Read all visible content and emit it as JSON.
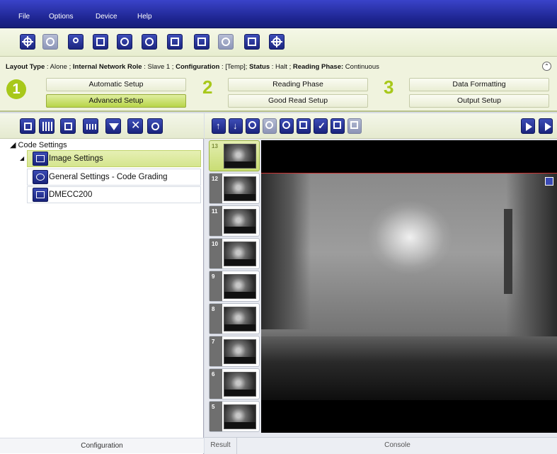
{
  "menu": [
    "File",
    "Options",
    "Device",
    "Help"
  ],
  "toolbar": {
    "icons": [
      "connect-icon",
      "device-discovery-icon",
      "user-icon",
      "window-icon",
      "image-capture-icon",
      "image-save-icon",
      "export-icon",
      "import-icon",
      "statistics-icon",
      "monitor-icon",
      "target-icon"
    ]
  },
  "status": {
    "layout_type_label": "Layout Type",
    "layout_type": "Alone",
    "network_role_label": "Internal Network Role",
    "network_role": "Slave 1",
    "configuration_label": "Configuration",
    "configuration": "[Temp]",
    "status_label": "Status",
    "status": "Halt",
    "reading_phase_label": "Reading Phase:",
    "reading_phase": "Continuous"
  },
  "workflow": {
    "step1": "1",
    "step2": "2",
    "step3": "3",
    "automatic_setup": "Automatic Setup",
    "advanced_setup": "Advanced Setup",
    "reading_phase": "Reading Phase",
    "good_read_setup": "Good Read Setup",
    "data_formatting": "Data Formatting",
    "output_setup": "Output Setup"
  },
  "tree": {
    "root": "Code Settings",
    "items": [
      "Image Settings",
      "General Settings - Code Grading",
      "DMECC200"
    ]
  },
  "left_footer": "Configuration",
  "thumbnails": [
    "13",
    "12",
    "11",
    "10",
    "9",
    "8",
    "7",
    "6",
    "5"
  ],
  "bottom": {
    "result_tab": "Result",
    "console_tab": "Console"
  }
}
